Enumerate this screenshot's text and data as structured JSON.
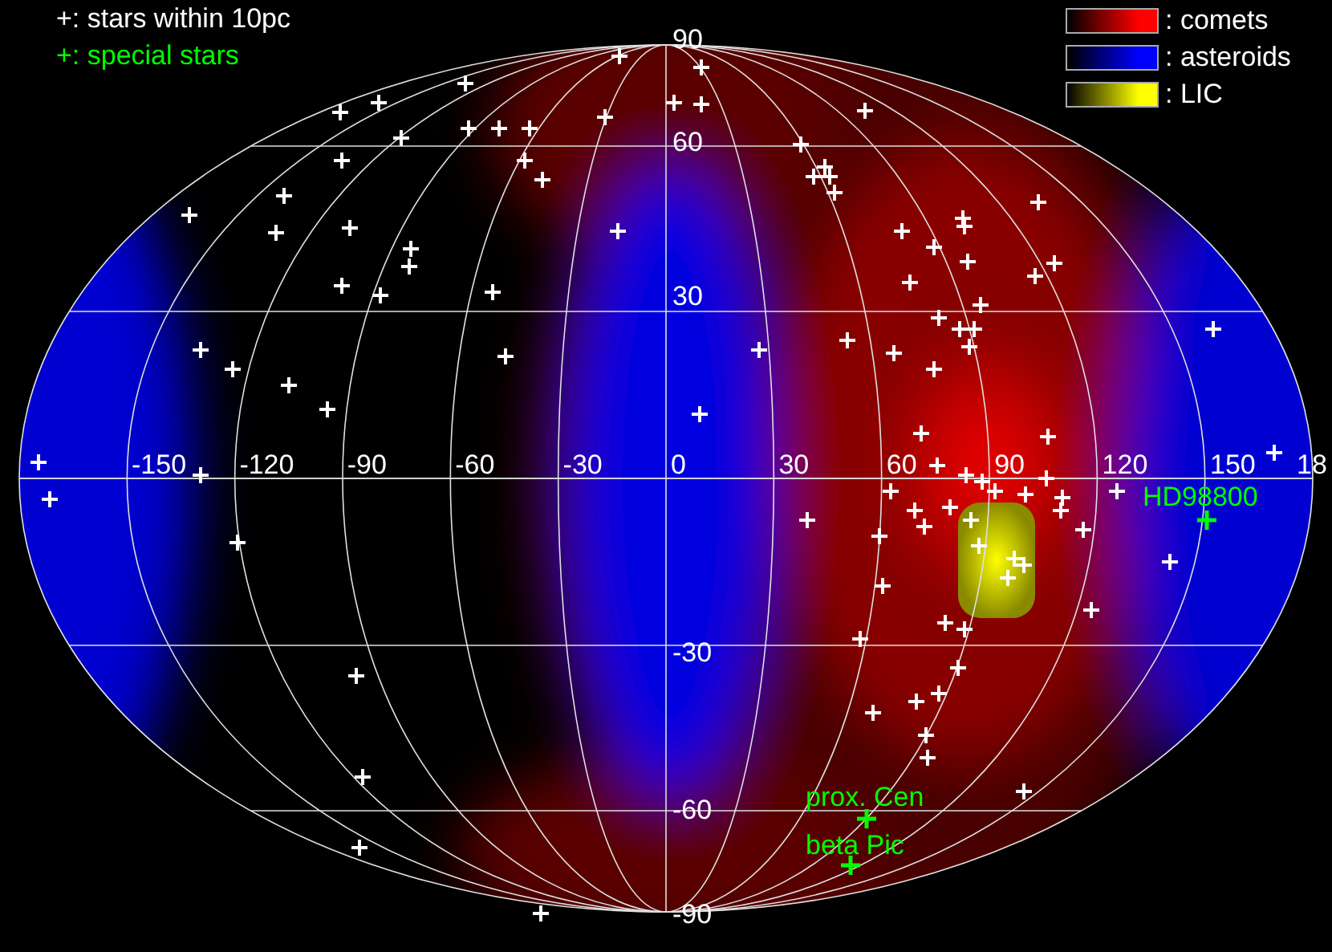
{
  "star_legend": [
    {
      "text": "+: stars within 10pc",
      "color": "#ffffff"
    },
    {
      "text": "+: special stars",
      "color": "#00ff00"
    }
  ],
  "map_legend": [
    {
      "text": ": comets",
      "color": "#ff0000"
    },
    {
      "text": ": asteroids",
      "color": "#0000ff"
    },
    {
      "text": ": LIC",
      "color": "#ffff00"
    }
  ],
  "longitude_labels": [
    "-150",
    "-120",
    "-90",
    "-60",
    "-30",
    "0",
    "30",
    "60",
    "90",
    "120",
    "150",
    "18"
  ],
  "latitude_labels": [
    "90",
    "60",
    "30",
    "-30",
    "-60",
    "-90"
  ],
  "special_stars": [
    {
      "label": "HD98800"
    },
    {
      "label": "prox. Cen"
    },
    {
      "label": "beta Pic"
    }
  ]
}
